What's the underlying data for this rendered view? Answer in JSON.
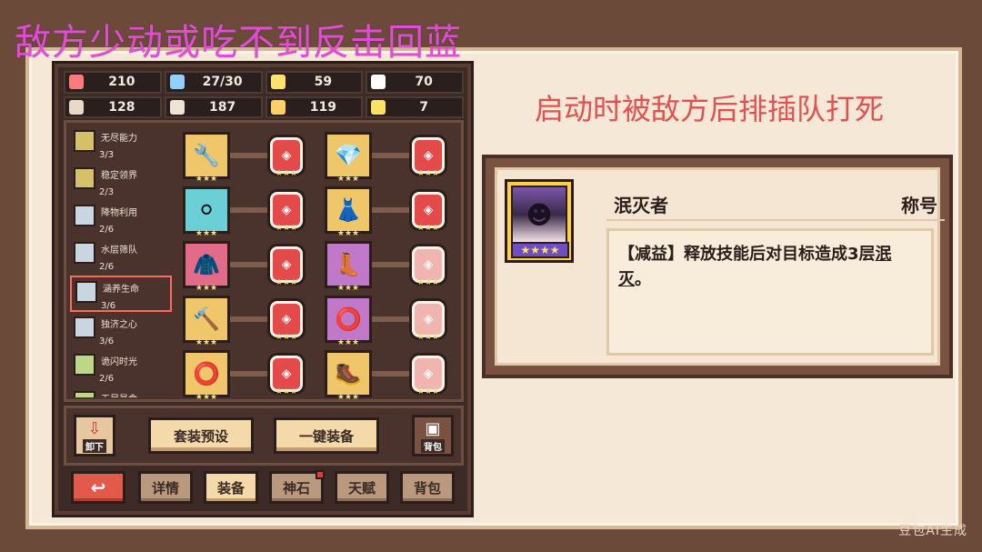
{
  "overlay": {
    "title": "敌方少动或吃不到反击回蓝"
  },
  "right": {
    "title": "启动时被敌方后排插队打死"
  },
  "stats": [
    {
      "icon": "heart-icon",
      "value": "210",
      "color": "#ff7a7a"
    },
    {
      "icon": "water-drop-icon",
      "value": "27/30",
      "color": "#8fd0ff"
    },
    {
      "icon": "shield-icon",
      "value": "59",
      "color": "#ffe36a"
    },
    {
      "icon": "rock-icon",
      "value": "70",
      "color": "#ffffff"
    },
    {
      "icon": "scroll-icon",
      "value": "128",
      "color": "#e8d9c8"
    },
    {
      "icon": "book-icon",
      "value": "187",
      "color": "#efe3d4"
    },
    {
      "icon": "tome-icon",
      "value": "119",
      "color": "#ffcf6a"
    },
    {
      "icon": "horseshoe-icon",
      "value": "7",
      "color": "#ffe16a"
    }
  ],
  "skills": [
    {
      "name": "无尽能力",
      "count": "3/3",
      "color": "#d6c06a"
    },
    {
      "name": "稳定领界",
      "count": "2/3",
      "color": "#d6c06a"
    },
    {
      "name": "降物利用",
      "count": "2/6",
      "color": "#c9d6e2"
    },
    {
      "name": "水层筛队",
      "count": "2/6",
      "color": "#c9d6e2"
    },
    {
      "name": "涵养生命",
      "count": "3/6",
      "color": "#c9d6e2"
    },
    {
      "name": "独济之心",
      "count": "3/6",
      "color": "#c9d6e2"
    },
    {
      "name": "诡闪时光",
      "count": "2/6",
      "color": "#bcd68a"
    },
    {
      "name": "无尽暴食",
      "count": "",
      "color": "#bcd68a"
    }
  ],
  "equipment": [
    {
      "icon": "wrench-icon",
      "bg": "#f0c66a",
      "glyph": "🔧",
      "stars": "★★★"
    },
    {
      "icon": "crystal-icon",
      "bg": "#f0c66a",
      "glyph": "💎",
      "stars": "★★★"
    },
    {
      "icon": "orb-icon",
      "bg": "#6ad0d6",
      "glyph": "⚪",
      "stars": "★★★"
    },
    {
      "icon": "dress-icon",
      "bg": "#f0c66a",
      "glyph": "👗",
      "stars": "★★★"
    },
    {
      "icon": "armor-icon",
      "bg": "#e46a8a",
      "glyph": "🧥",
      "stars": "★★★"
    },
    {
      "icon": "boots-icon",
      "bg": "#c078c8",
      "glyph": "👢",
      "stars": "★★★"
    },
    {
      "icon": "club-icon",
      "bg": "#f0c66a",
      "glyph": "🔨",
      "stars": "★★★"
    },
    {
      "icon": "ring-icon",
      "bg": "#c078c8",
      "glyph": "⭕",
      "stars": "★★★"
    },
    {
      "icon": "bracelet-icon",
      "bg": "#f0c66a",
      "glyph": "⭕",
      "stars": "★★★"
    },
    {
      "icon": "greaves-icon",
      "bg": "#f0c66a",
      "glyph": "🥾",
      "stars": "★★★"
    }
  ],
  "gems": [
    {
      "stars": "★★★",
      "pale": false
    },
    {
      "stars": "★★★",
      "pale": false
    },
    {
      "stars": "★★★",
      "pale": false
    },
    {
      "stars": "★★★",
      "pale": false
    },
    {
      "stars": "★★★",
      "pale": false
    },
    {
      "stars": "★★★",
      "pale": true
    },
    {
      "stars": "★★★",
      "pale": false
    },
    {
      "stars": "★★★",
      "pale": true
    },
    {
      "stars": "★★★",
      "pale": false
    },
    {
      "stars": "★★★",
      "pale": true
    }
  ],
  "actions": {
    "unequip_label": "卸下",
    "preset_label": "套装预设",
    "one_key_label": "一键装备",
    "bag_label": "背包"
  },
  "tabs": {
    "back": "↩",
    "details": "详情",
    "equipment": "装备",
    "divine_stone": "神石",
    "talent": "天赋",
    "bag": "背包"
  },
  "card": {
    "name": "泯灭者",
    "tag": "称号",
    "avatar_stars": "★★★★",
    "desc_prefix": "【减益】释放技能后对目标造成3层",
    "desc_keyword": "泯灭",
    "desc_suffix": "。"
  },
  "watermark": "豆包AI生成"
}
